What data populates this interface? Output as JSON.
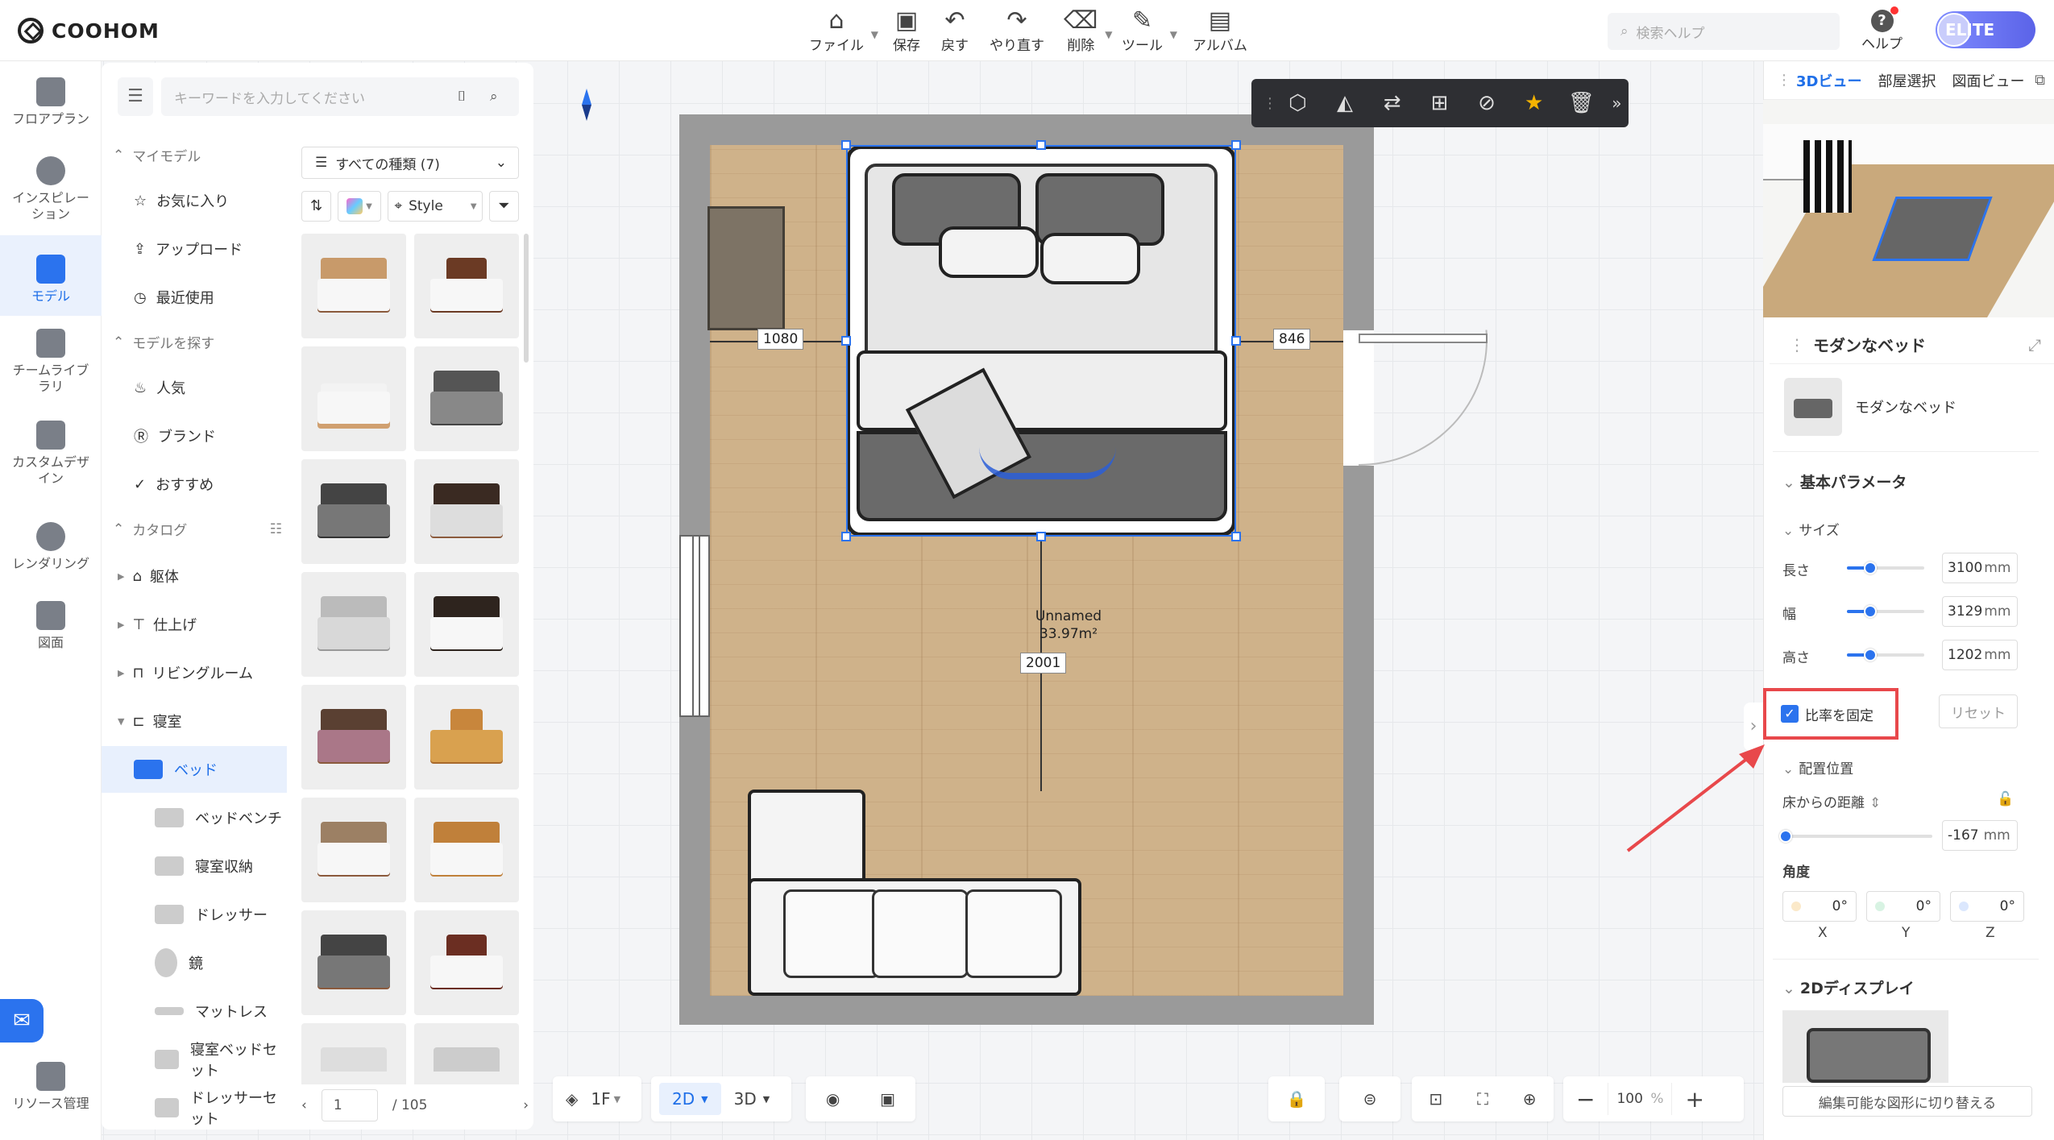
{
  "app": {
    "brand": "COOHOM"
  },
  "toolbar": {
    "file": "ファイル",
    "save": "保存",
    "undo": "戻す",
    "redo": "やり直す",
    "delete": "削除",
    "tools": "ツール",
    "album": "アルバム"
  },
  "header": {
    "search_placeholder": "検索ヘルプ",
    "help": "ヘルプ",
    "plan": "ELITE"
  },
  "leftnav": {
    "items": [
      {
        "label": "フロアプラン"
      },
      {
        "label": "インスピレーション"
      },
      {
        "label": "モデル"
      },
      {
        "label": "チームライブラリ"
      },
      {
        "label": "カスタムデザイン"
      },
      {
        "label": "レンダリング"
      },
      {
        "label": "図面"
      },
      {
        "label": "リソース管理"
      }
    ]
  },
  "catalog": {
    "search_placeholder": "キーワードを入力してください",
    "my_models": "マイモデル",
    "favorites": "お気に入り",
    "upload": "アップロード",
    "recent": "最近使用",
    "find_models": "モデルを探す",
    "popular": "人気",
    "brand": "ブランド",
    "recommended": "おすすめ",
    "catalog": "カタログ",
    "categories": [
      {
        "label": "躯体"
      },
      {
        "label": "仕上げ"
      },
      {
        "label": "リビングルーム"
      },
      {
        "label": "寝室"
      }
    ],
    "subcategories": [
      {
        "label": "ベッド"
      },
      {
        "label": "ベッドベンチ"
      },
      {
        "label": "寝室収納"
      },
      {
        "label": "ドレッサー"
      },
      {
        "label": "鏡"
      },
      {
        "label": "マットレス"
      },
      {
        "label": "寝室ベッドセット"
      },
      {
        "label": "ドレッサーセット"
      }
    ],
    "filter_type": "すべての種類 (7)",
    "style": "Style",
    "page": "1",
    "page_total": "/ 105"
  },
  "canvas": {
    "dim_left": "1080",
    "dim_right": "846",
    "dim_bottom": "2001",
    "room_name": "Unnamed",
    "room_area": "33.97m²"
  },
  "bottom": {
    "floor": "1F",
    "view2d": "2D",
    "view3d": "3D",
    "zoom": "100",
    "zoom_unit": "%"
  },
  "rpanel": {
    "tabs": [
      "3Dビュー",
      "部屋選択",
      "図面ビュー"
    ],
    "props_title": "モダンなベッド",
    "object_name": "モダンなベッド",
    "basic_params": "基本パラメータ",
    "size": "サイズ",
    "length_label": "長さ",
    "length_value": "3100",
    "width_label": "幅",
    "width_value": "3129",
    "height_label": "高さ",
    "height_value": "1202",
    "unit_mm": "mm",
    "lock_ratio": "比率を固定",
    "reset": "リセット",
    "placement": "配置位置",
    "floor_distance": "床からの距離",
    "floor_distance_value": "-167",
    "angle": "角度",
    "angle_x": "0°",
    "angle_y": "0°",
    "angle_z": "0°",
    "axis_x": "X",
    "axis_y": "Y",
    "axis_z": "Z",
    "display2d": "2Dディスプレイ",
    "switch_shape": "編集可能な図形に切り替える"
  },
  "sliders": {
    "length": 0.3,
    "width": 0.3,
    "height": 0.3,
    "floor_distance": 0.02
  },
  "colors": {
    "accent": "#2b73ee",
    "highlight": "#e8484b",
    "star": "#f5b301"
  }
}
